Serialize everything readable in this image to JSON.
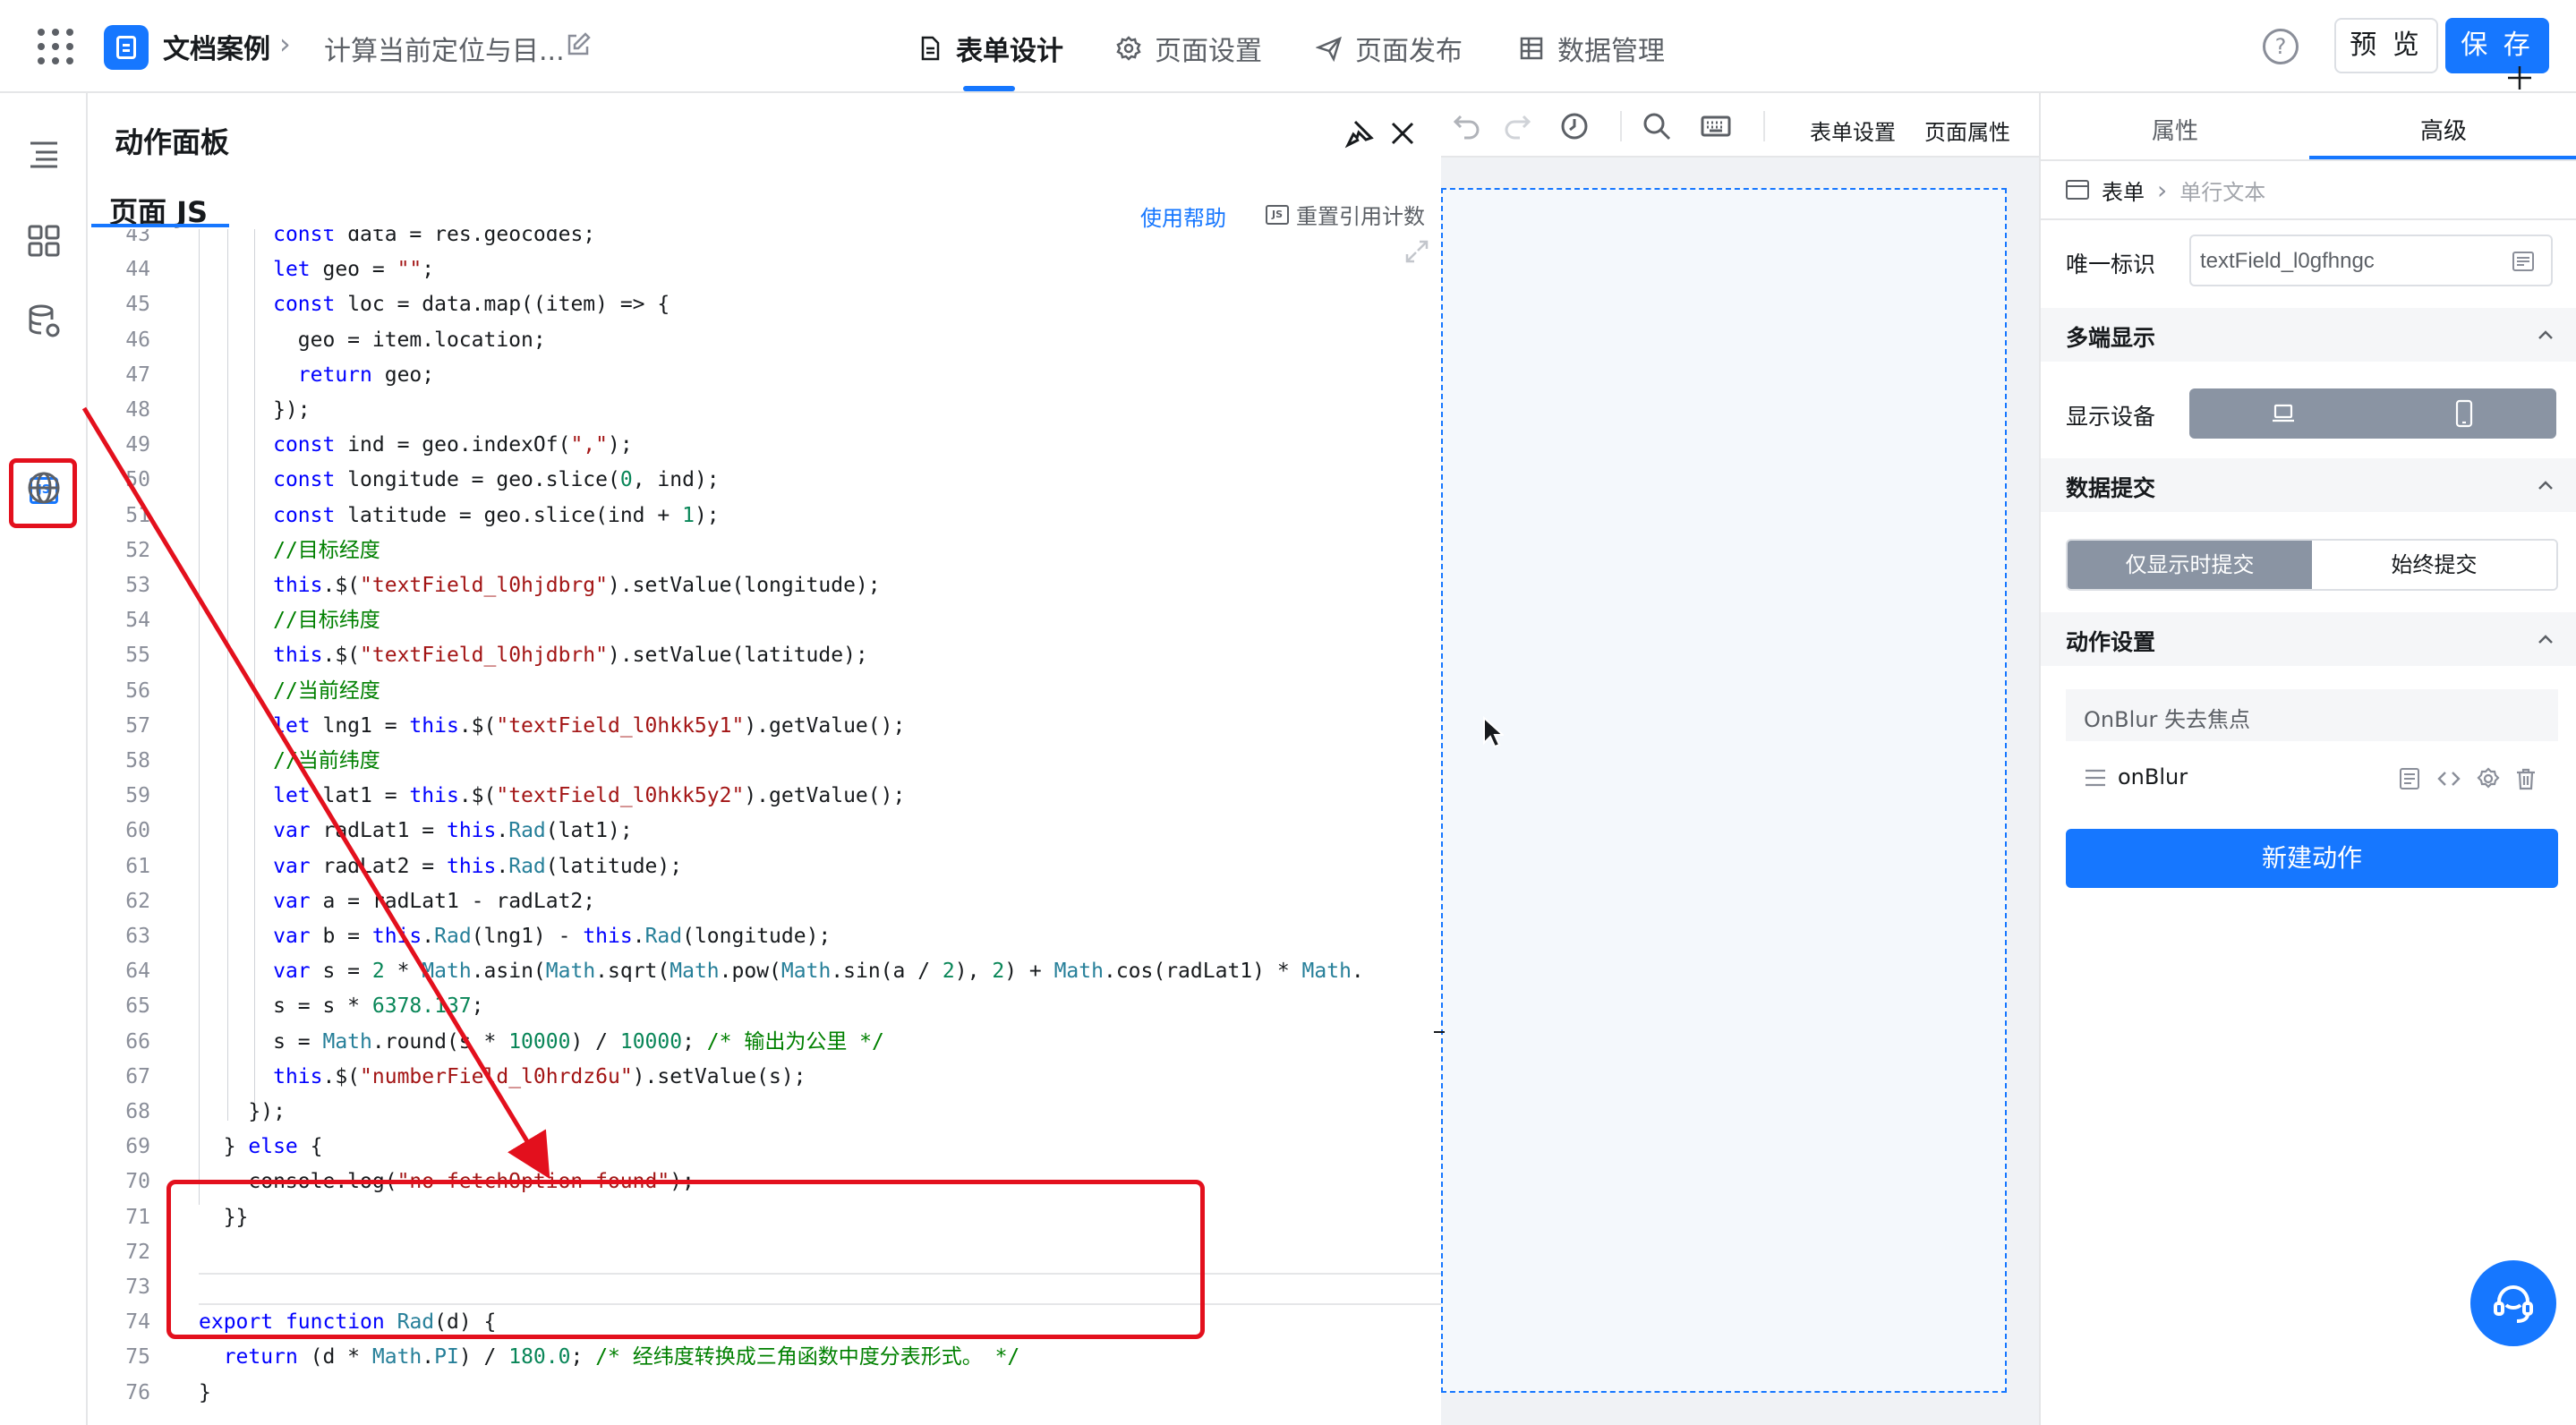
{
  "topbar": {
    "app_name": "文档案例",
    "page_name": "计算当前定位与目...",
    "tabs": [
      {
        "label": "表单设计",
        "active": true
      },
      {
        "label": "页面设置",
        "active": false
      },
      {
        "label": "页面发布",
        "active": false
      },
      {
        "label": "数据管理",
        "active": false
      }
    ],
    "help": "?",
    "preview_label": "预 览",
    "save_label": "保 存",
    "accent": "#1677ff"
  },
  "panel": {
    "title": "动作面板",
    "tab": "页面 JS",
    "help_link": "使用帮助",
    "reset_label": "重置引用计数",
    "js_badge": "JS",
    "lines": [
      {
        "n": 43,
        "code": "      const data = res.geocodes;"
      },
      {
        "n": 44,
        "code": "      let geo = \"\";"
      },
      {
        "n": 45,
        "code": "      const loc = data.map((item) => {"
      },
      {
        "n": 46,
        "code": "        geo = item.location;"
      },
      {
        "n": 47,
        "code": "        return geo;"
      },
      {
        "n": 48,
        "code": "      });"
      },
      {
        "n": 49,
        "code": "      const ind = geo.indexOf(\",\");"
      },
      {
        "n": 50,
        "code": "      const longitude = geo.slice(0, ind);"
      },
      {
        "n": 51,
        "code": "      const latitude = geo.slice(ind + 1);"
      },
      {
        "n": 52,
        "code": "      //目标经度"
      },
      {
        "n": 53,
        "code": "      this.$(\"textField_l0hjdbrg\").setValue(longitude);"
      },
      {
        "n": 54,
        "code": "      //目标纬度"
      },
      {
        "n": 55,
        "code": "      this.$(\"textField_l0hjdbrh\").setValue(latitude);"
      },
      {
        "n": 56,
        "code": "      //当前经度"
      },
      {
        "n": 57,
        "code": "      let lng1 = this.$(\"textField_l0hkk5y1\").getValue();"
      },
      {
        "n": 58,
        "code": "      //当前纬度"
      },
      {
        "n": 59,
        "code": "      let lat1 = this.$(\"textField_l0hkk5y2\").getValue();"
      },
      {
        "n": 60,
        "code": "      var radLat1 = this.Rad(lat1);"
      },
      {
        "n": 61,
        "code": "      var radLat2 = this.Rad(latitude);"
      },
      {
        "n": 62,
        "code": "      var a = radLat1 - radLat2;"
      },
      {
        "n": 63,
        "code": "      var b = this.Rad(lng1) - this.Rad(longitude);"
      },
      {
        "n": 64,
        "code": "      var s = 2 * Math.asin(Math.sqrt(Math.pow(Math.sin(a / 2), 2) + Math.cos(radLat1) * Math."
      },
      {
        "n": 65,
        "code": "      s = s * 6378.137;"
      },
      {
        "n": 66,
        "code": "      s = Math.round(s * 10000) / 10000; /* 输出为公里 */"
      },
      {
        "n": 67,
        "code": "      this.$(\"numberField_l0hrdz6u\").setValue(s);"
      },
      {
        "n": 68,
        "code": "    });"
      },
      {
        "n": 69,
        "code": "  } else {"
      },
      {
        "n": 70,
        "code": "    console.log(\"no fetchOption found\");"
      },
      {
        "n": 71,
        "code": "  }}"
      },
      {
        "n": 72,
        "code": ""
      },
      {
        "n": 73,
        "code": ""
      },
      {
        "n": 74,
        "code": "export function Rad(d) {"
      },
      {
        "n": 75,
        "code": "  return (d * Math.PI) / 180.0; /* 经纬度转换成三角函数中度分表形式。 */"
      },
      {
        "n": 76,
        "code": "}"
      }
    ]
  },
  "canvas_toolbar": {
    "form_settings": "表单设置",
    "page_props": "页面属性"
  },
  "right": {
    "tabs": [
      "属性",
      "高级"
    ],
    "breadcrumb": [
      "表单",
      "单行文本"
    ],
    "unique_id_label": "唯一标识",
    "unique_id_value": "textField_l0gfhngc",
    "multi_display": "多端显示",
    "display_device": "显示设备",
    "data_submit": "数据提交",
    "submit_options": [
      "仅显示时提交",
      "始终提交"
    ],
    "action_settings": "动作设置",
    "event_name": "OnBlur 失去焦点",
    "handler": "onBlur",
    "new_action": "新建动作"
  },
  "annotation_color": "#e3101d"
}
